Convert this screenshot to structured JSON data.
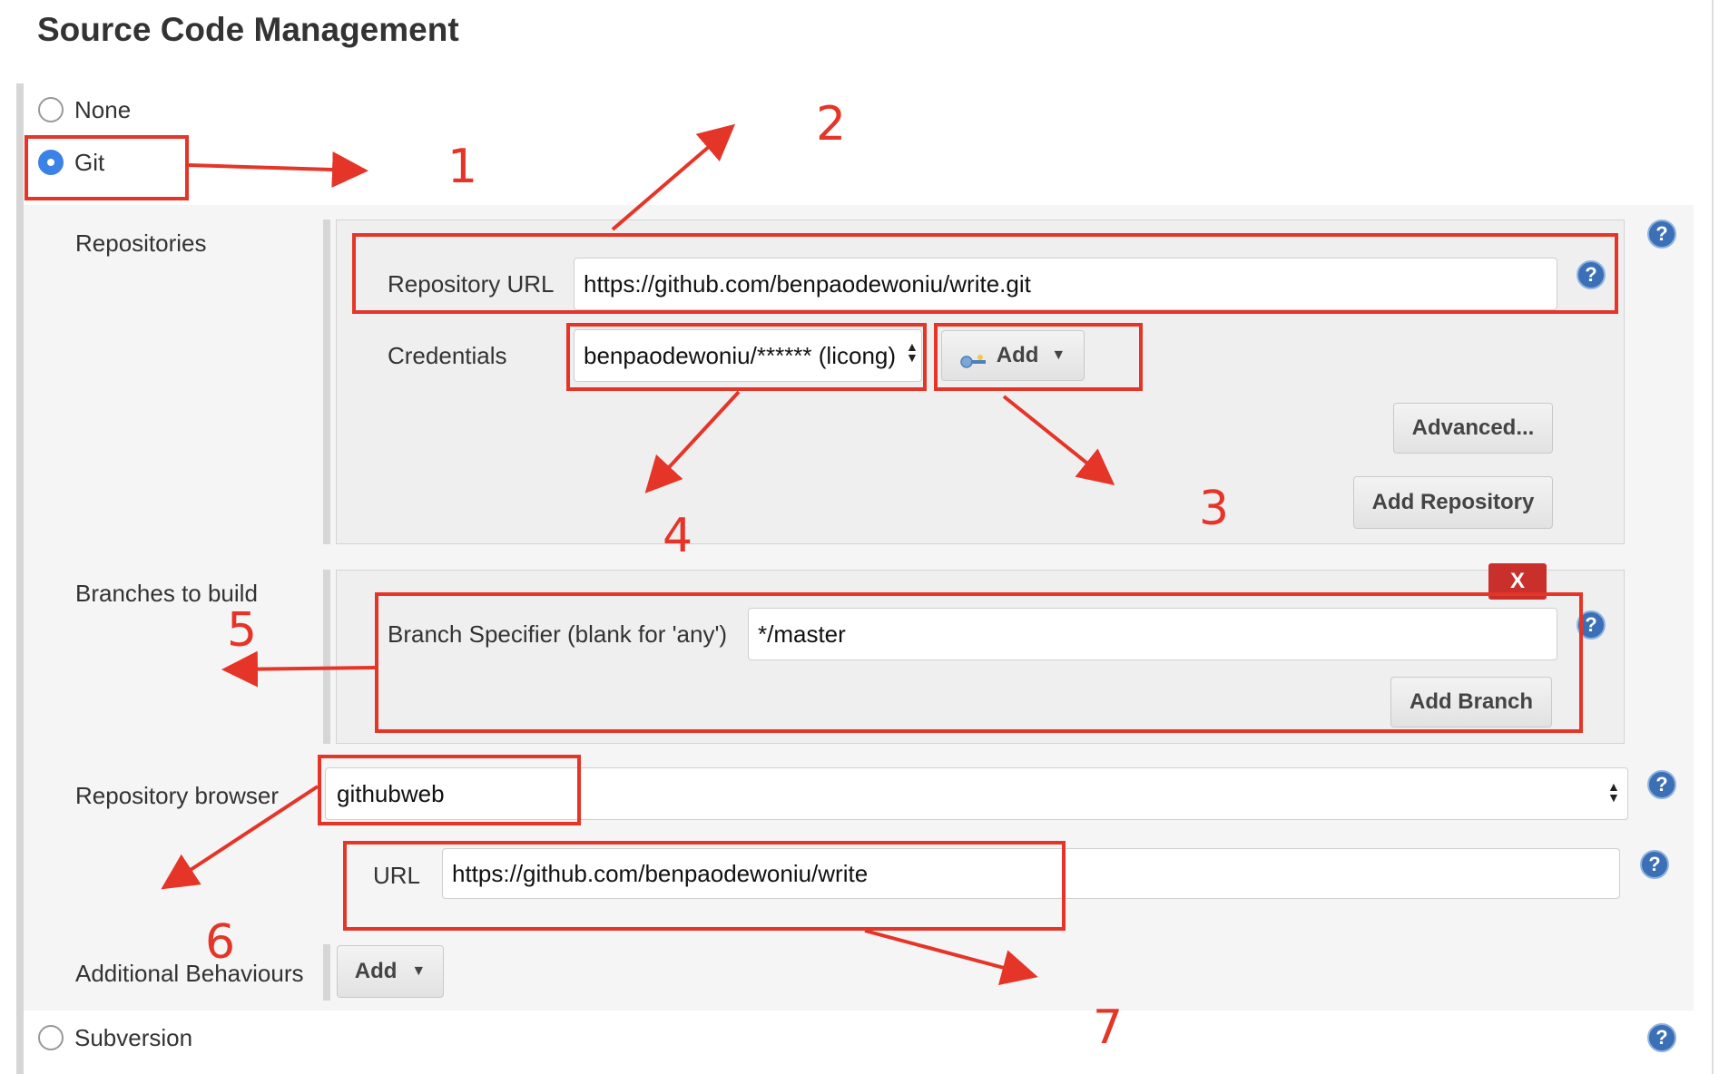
{
  "section_title": "Source Code Management",
  "scm_options": {
    "none": "None",
    "git": "Git",
    "subversion": "Subversion"
  },
  "repositories": {
    "label": "Repositories",
    "url_label": "Repository URL",
    "url_value": "https://github.com/benpaodewoniu/write.git",
    "credentials_label": "Credentials",
    "credentials_value": "benpaodewoniu/****** (licong)",
    "add_label": "Add",
    "advanced_label": "Advanced...",
    "add_repository_label": "Add Repository"
  },
  "branches": {
    "label": "Branches to build",
    "delete_label": "X",
    "specifier_label": "Branch Specifier (blank for 'any')",
    "specifier_value": "*/master",
    "add_branch_label": "Add Branch"
  },
  "repo_browser": {
    "label": "Repository browser",
    "value": "githubweb",
    "url_label": "URL",
    "url_value": "https://github.com/benpaodewoniu/write"
  },
  "additional": {
    "label": "Additional Behaviours",
    "add_label": "Add"
  },
  "help_icon": "?",
  "annotations": [
    "1",
    "2",
    "3",
    "4",
    "5",
    "6",
    "7"
  ],
  "colors": {
    "annotation_red": "#e53528",
    "radio_selected": "#3b82e6",
    "help_blue": "#3b6fb6",
    "delete_red": "#c9302c"
  }
}
